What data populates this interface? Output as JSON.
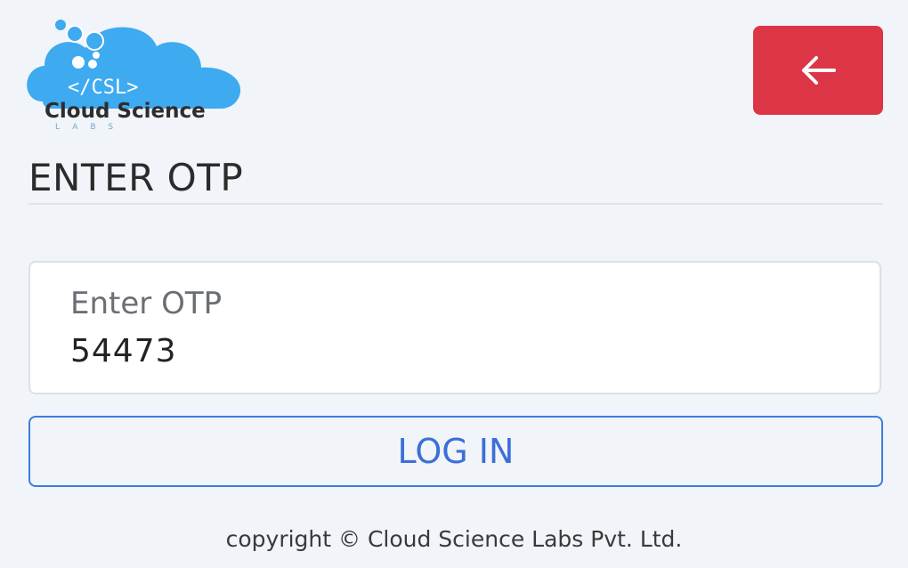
{
  "logo": {
    "code_mark": "</CSL>",
    "name": "Cloud Science",
    "sub": "LABS",
    "cloud_color": "#3eaaf0"
  },
  "header": {
    "back_icon": "arrow-left-icon",
    "back_color": "#dc3545"
  },
  "page": {
    "title": "ENTER OTP"
  },
  "otp": {
    "label": "Enter OTP",
    "value": "54473"
  },
  "actions": {
    "login_label": "LOG IN",
    "accent": "#3b7ddd"
  },
  "footer": {
    "copyright": "copyright © Cloud Science Labs Pvt. Ltd."
  }
}
